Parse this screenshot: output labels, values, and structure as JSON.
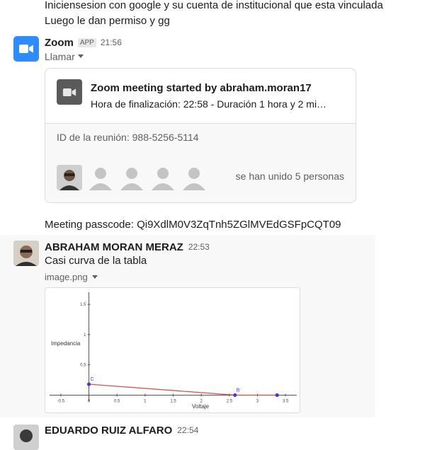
{
  "messages": {
    "prev_line1": "Iniciensesion con google y su cuenta de institucional que esta vinculada",
    "prev_line2": "Luego le dan permiso y gg",
    "zoom": {
      "sender": "Zoom",
      "badge": "APP",
      "time": "21:56",
      "action": "Llamar",
      "card_title": "Zoom meeting started by abraham.moran17",
      "card_subtitle": "Hora de finalización: 22:58 - Duración 1 hora y 2 mi…",
      "meeting_id": "ID de la reunión: 988-5256-5114",
      "joined": "se han unido 5 personas"
    },
    "passcode": "Meeting passcode: Qi9XdlM0V3ZqTnh5ZGlMVEdGSFpCQT09",
    "abraham": {
      "sender": "ABRAHAM MORAN MERAZ",
      "time": "22:53",
      "text": "Casi curva de la tabla",
      "attachment": "image.png"
    },
    "eduardo": {
      "sender": "EDUARDO RUIZ ALFARO",
      "time": "22:54"
    }
  },
  "colors": {
    "zoom_blue": "#2d8cff",
    "curve": "#d9534f",
    "points": "#3b3bd1"
  },
  "chart_data": {
    "type": "line",
    "xlabel": "Voltaje",
    "ylabel": "Impedancia",
    "x_ticks": [
      "-0.5",
      "0",
      "0.5",
      "1",
      "1.5",
      "2",
      "2.5",
      "3",
      "3.5"
    ],
    "y_ticks": [
      "0.5",
      "1",
      "1.5"
    ],
    "xlim": [
      -0.7,
      3.7
    ],
    "ylim": [
      -0.1,
      1.7
    ],
    "points": [
      {
        "label": "C",
        "x": 0.0,
        "y": 0.18
      },
      {
        "label": "B",
        "x": 2.6,
        "y": 0.0
      },
      {
        "label": "",
        "x": 3.35,
        "y": 0.0
      }
    ],
    "grid": false
  }
}
